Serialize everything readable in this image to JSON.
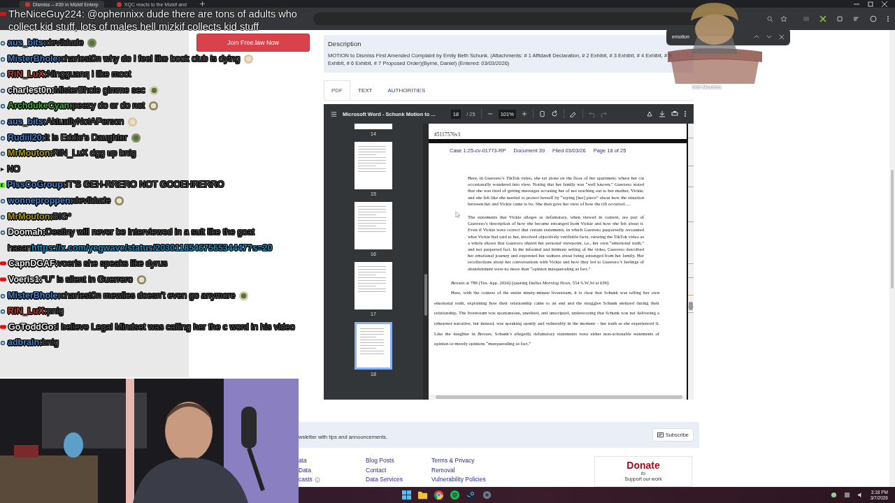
{
  "browser": {
    "tabs": [
      {
        "title": "Dismiss – #39 in Mizkif Enterp",
        "selected": true
      },
      {
        "title": "XQC reacts to the Mizkif and",
        "selected": false
      }
    ],
    "find_bar": {
      "value": "emotion"
    }
  },
  "join_button": "Join Free.law Now",
  "description": {
    "heading": "Description",
    "text": "MOTION to Dismiss First Amended Complaint by Emily Beth Schunk. (Attachments: # 1 Affidavit Declaration, # 2 Exhibit, # 3 Exhibit, # 4 Exhibit, # 5 Exhibit, # 6 Exhibit, # 7 Proposed Order)(Byrne, Daniel) (Entered: 03/03/2026)"
  },
  "tabs": [
    {
      "label": "PDF",
      "selected": true
    },
    {
      "label": "TEXT",
      "selected": false
    },
    {
      "label": "AUTHORITIES",
      "selected": false
    }
  ],
  "pdf_viewer": {
    "title": "Microsoft Word - Schunk Motion to ...",
    "page": "18",
    "page_count": "/ 25",
    "zoom": "101%",
    "thumbnails": [
      {
        "label": "14",
        "selected": false
      },
      {
        "label": "15",
        "selected": false
      },
      {
        "label": "16",
        "selected": false
      },
      {
        "label": "17",
        "selected": false
      },
      {
        "label": "18",
        "selected": true
      }
    ],
    "prev_page_footer": "#5117576v3",
    "page_header": [
      "Case 1:25-cv-01773-RP",
      "Document 39",
      "Filed 03/03/26",
      "Page 18 of 25"
    ],
    "block_quotes": [
      "Here, in Guerrero’s TikTok video, she sat alone on the floor of her apartment, where her cat occasionally wandered into view. Noting that her family was “well known,” Guerrero stated that she was tired of getting messages accusing her of not reaching out to her mother, Vickie, and she felt like she needed to protect herself by “saying [her] piece” about how the situation between her and Vickie came to be. She then gave her view of how the rift occurred….",
      "The statements that Vickie alleges as defamatory, when viewed in context, are part of Guerrero’s description of how she became estranged from Vickie and how she felt about it. Even if Vickie were correct that certain statements, in which Guerrero purportedly recounted what Vickie had said to her, involved objectively verifiable facts, viewing the TikTok video as a whole shows that Guerrero shared her personal viewpoint, i.e., her own “emotional truth,” and not purported fact. In the informal and intimate setting of the video, Guerrero described her emotional journey and expressed her sadness about being estranged from her family. Her recollections about her conversations with Vickie and how they led to Guerrero’s feelings of abandonment were no more than “opinion masquerading as fact.”"
    ],
    "citation": "*Benson* at 789 (Tex. App. 2024) (quoting *Dallas Morning News*, 554 S.W.3d at 639).",
    "body": "Here, with the context of the entire ninety-minute livestream, it is clear that Schunk was telling her own emotional truth, explaining how their relationship came to an end and the struggles Schunk endured during their relationship. The livestream was spontaneous, unedited, and unscripted, underscoring that Schunk was not delivering a rehearsed narrative, but instead, was speaking openly and vulnerably in the moment – her truth as she experienced it. Like the daughter in *Benson*, Schunk’s allegedly defamatory statements were either non-actionable statements of opinion or merely opinions “masquerading as fact.”"
  },
  "footer": {
    "newsletter": "wsletter with tips and announcements.",
    "subscribe": "Subscribe",
    "link_columns": [
      [
        {
          "label": "ata",
          "info": false
        },
        {
          "label": "Data",
          "info": false
        },
        {
          "label": "casts",
          "info": true
        }
      ],
      [
        {
          "label": "Blog Posts",
          "info": false
        },
        {
          "label": "Contact",
          "info": false
        },
        {
          "label": "Data Services",
          "info": false
        }
      ],
      [
        {
          "label": "Terms & Privacy",
          "info": false
        },
        {
          "label": "Removal",
          "info": false
        },
        {
          "label": "Vulnerability Policies",
          "info": false
        }
      ]
    ],
    "donate": {
      "title": "Donate",
      "connector": "to",
      "text": "Support our work"
    }
  },
  "chat": {
    "pinned": {
      "user": "TheNiceGuy224:",
      "text": "@ophennixx dude there are tons of adults who collect kid stuff, lots of males hell mizkif collects kid stuff"
    },
    "messages": [
      {
        "kind": "circle",
        "user": "aus_bits:",
        "color": "#3d7fc4",
        "text": "devildude",
        "emote": true
      },
      {
        "kind": "circle",
        "user": "MisterBhole:",
        "color": "#3d7fc4",
        "text": "charlest0n why do I feel like book club is dying",
        "emote": true
      },
      {
        "kind": "circle",
        "user": "RiN_LuX:",
        "color": "#b8412c",
        "text": "Ningguanq i like moot",
        "emote": false
      },
      {
        "kind": "circle",
        "user": "charlest0n:",
        "color": "#e6e6e6",
        "text": "MisterBhole gimme sec",
        "emote": true
      },
      {
        "kind": "circle",
        "user": "ArchdukeCyan:",
        "color": "#3fa53a",
        "text": "peezy do or do not",
        "emote": true
      },
      {
        "kind": "circle",
        "user": "aus_bits:",
        "color": "#3d7fc4",
        "text": "AktuallyNotAPerson",
        "emote": true
      },
      {
        "kind": "circle",
        "user": "Rudiil20:",
        "color": "#3d7fc4",
        "text": "It is Eddie's Daughter",
        "emote": true
      },
      {
        "kind": "circle",
        "user": "MrMouton:",
        "color": "#a89a00",
        "text": "RiN_LuX dgg up bnig",
        "emote": false
      },
      {
        "kind": "arrow",
        "text": "NO",
        "emote": false
      },
      {
        "kind": "kick",
        "user": "PissCoGroup:",
        "color": "#3d7fc4",
        "text": "IT'S GEH-RRERO NOT GOOEHRERRO",
        "emote": false
      },
      {
        "kind": "circle",
        "user": "wonneproppen:",
        "color": "#3d7fc4",
        "text": "devildude",
        "emote": true
      },
      {
        "kind": "circle",
        "user": "MrMouton:",
        "color": "#a89a00",
        "text": "BIG*",
        "emote": false
      },
      {
        "kind": "circle",
        "user": "Doomah:",
        "color": "#e6e6e6",
        "text": "Destiny will never be interviewed in a suit like the goat hasan",
        "link": "https://x.com/yegwave/status/2030118546756534447?s=20",
        "emote": false
      },
      {
        "kind": "youtube",
        "user": "CapnDGAF:",
        "color": "#e6e6e6",
        "text": "voeris she speaks like dyrus",
        "emote": false
      },
      {
        "kind": "youtube",
        "user": "Voeris1:",
        "color": "#e6e6e6",
        "text": "“U” is silent in Guerrero",
        "emote": true
      },
      {
        "kind": "circle",
        "user": "MisterBhole:",
        "color": "#3d7fc4",
        "text": "charlest0n mewlies doesn't even go anymore",
        "emote": true
      },
      {
        "kind": "circle",
        "user": "RiN_LuX:",
        "color": "#b8412c",
        "text": "pnig",
        "emote": false
      },
      {
        "kind": "youtube",
        "user": "GoToddGo:",
        "color": "#e6e6e6",
        "text": "I believe Legal Mindset was calling her the c word in his video",
        "emote": false
      },
      {
        "kind": "circle",
        "user": "adbrain:",
        "color": "#3d7fc4",
        "text": "bnig",
        "emote": false
      }
    ]
  },
  "overlay": {
    "label": "Not Mouton"
  },
  "taskbar": {
    "time": "3:18 PM",
    "date": "3/7/2026"
  }
}
